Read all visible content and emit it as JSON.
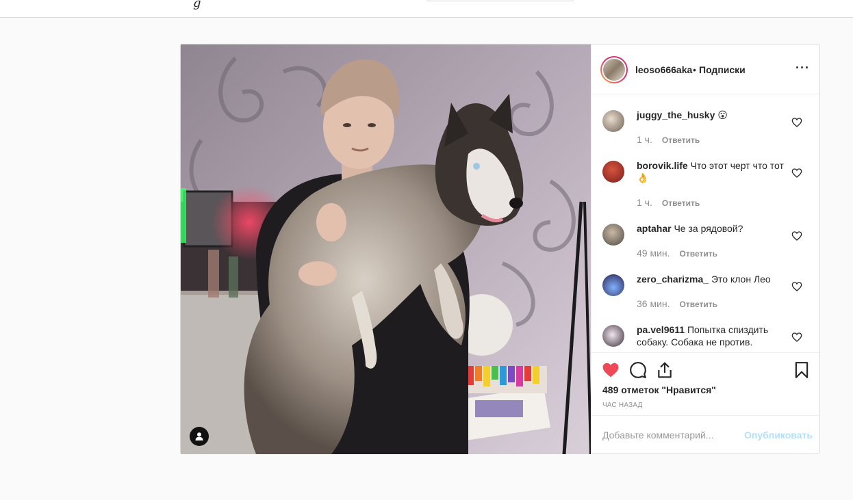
{
  "topnav": {
    "logo_fragment": "g"
  },
  "post": {
    "author": "leoso666aka",
    "separator": "•",
    "follow_label": "Подписки",
    "more_label": "···",
    "comments": [
      {
        "user": "juggy_the_husky",
        "text": "😮",
        "time": "1 ч.",
        "reply": "Ответить"
      },
      {
        "user": "borovik.life",
        "text": "Что этот черт что тот 👌",
        "time": "1 ч.",
        "reply": "Ответить"
      },
      {
        "user": "aptahar",
        "text": "Че за рядовой?",
        "time": "49 мин.",
        "reply": "Ответить"
      },
      {
        "user": "zero_charizma_",
        "text": "Это клон Лео",
        "time": "36 мин.",
        "reply": "Ответить"
      },
      {
        "user": "pa.vel9611",
        "text": "Попытка спиздить собаку. Собака не против.",
        "time": "",
        "reply": ""
      }
    ],
    "likes_text": "489 отметок \"Нравится\"",
    "time_ago": "ЧАС НАЗАД",
    "comment_placeholder": "Добавьте комментарий...",
    "publish_label": "Опубликовать",
    "colors": {
      "like_red": "#ed4956",
      "publish_disabled": "#b2dffc",
      "meta_gray": "#8e8e8e"
    },
    "icons": [
      "heart-icon",
      "comment-icon",
      "share-icon",
      "bookmark-icon",
      "user-tag-icon",
      "ellipsis-icon"
    ]
  }
}
